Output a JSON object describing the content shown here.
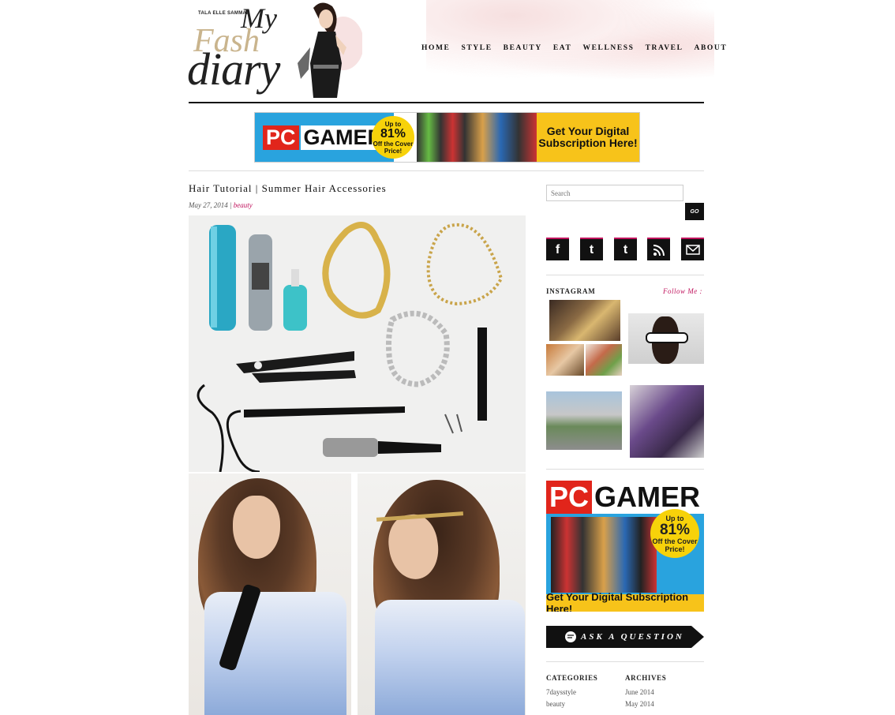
{
  "site": {
    "tagline": "TALA ELLE SAMMAN",
    "logo_my": "My",
    "logo_fash": "Fash",
    "logo_diary": "diary"
  },
  "nav": [
    "HOME",
    "STYLE",
    "BEAUTY",
    "EAT",
    "WELLNESS",
    "TRAVEL",
    "ABOUT"
  ],
  "top_ad": {
    "pc": "PC",
    "gamer": "GAMER",
    "offer_top": "Up to",
    "offer_pct": "81%",
    "offer_bottom": "Off the Cover Price!",
    "cta": "Get Your Digital Subscription Here!"
  },
  "post": {
    "title": "Hair Tutorial | Summer Hair Accessories",
    "date": "May 27, 2014",
    "category": "beauty"
  },
  "sidebar": {
    "search_placeholder": "Search",
    "go_label": "GO",
    "social": [
      "f",
      "t",
      "t",
      "rss",
      "mail"
    ],
    "instagram_heading": "INSTAGRAM",
    "follow_label": "Follow Me :",
    "side_ad": {
      "pc": "PC",
      "gamer": "GAMER",
      "offer_top": "Up to",
      "offer_pct": "81%",
      "offer_bottom": "Off the Cover Price!",
      "cta": "Get Your Digital Subscription Here!"
    },
    "ask_label": "ASK A QUESTION",
    "categories_heading": "CATEGORIES",
    "archives_heading": "ARCHIVES",
    "categories": [
      "7daysstyle",
      "beauty"
    ],
    "archives": [
      "June 2014",
      "May 2014"
    ]
  },
  "colors": {
    "accent": "#c0135d",
    "text": "#222222",
    "rule": "#111111"
  }
}
